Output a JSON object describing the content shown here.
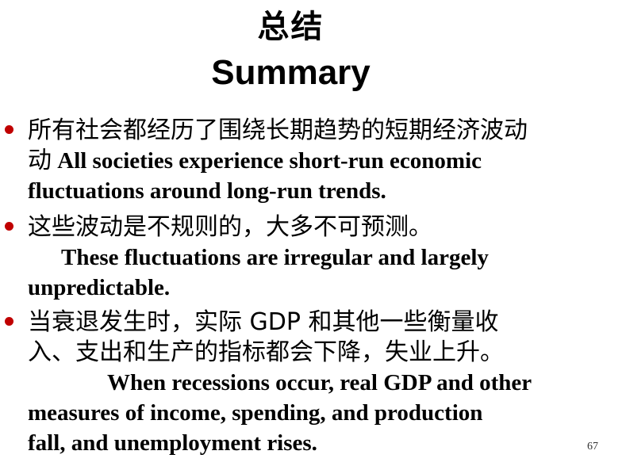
{
  "title": {
    "chinese": "总结",
    "english": "Summary"
  },
  "bullets": [
    {
      "chinese": "所有社会都经历了围绕长期趋势的短期经济波动",
      "english_lines": [
        "All societies experience short-run economic",
        "fluctuations around long-run trends."
      ]
    },
    {
      "chinese": "这些波动是不规则的，大多不可预测。",
      "english_lines": [
        "These fluctuations are irregular and largely",
        "unpredictable."
      ]
    },
    {
      "chinese_line1": "当衰退发生时，实际 GDP 和其他一些衡量收",
      "chinese_line2": "入、支出和生产的指标都会下降，失业上升。",
      "english_lines": [
        "When recessions occur, real GDP and other",
        "measures of income, spending, and production",
        "fall, and unemployment rises."
      ]
    }
  ],
  "page_number": "67",
  "colors": {
    "bullet": "#c00000",
    "text": "#000000",
    "background": "#ffffff"
  }
}
